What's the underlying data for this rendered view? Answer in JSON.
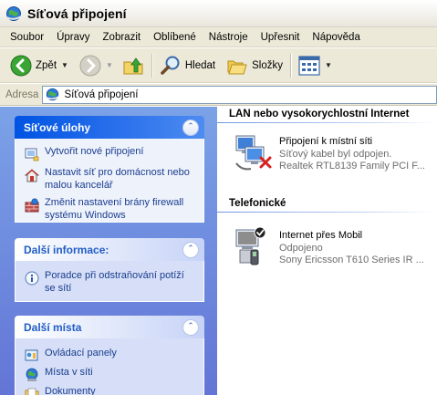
{
  "window": {
    "title": "Síťová připojení"
  },
  "menu": [
    "Soubor",
    "Úpravy",
    "Zobrazit",
    "Oblíbené",
    "Nástroje",
    "Upřesnit",
    "Nápověda"
  ],
  "toolbar": {
    "back_label": "Zpět",
    "search_label": "Hledat",
    "folders_label": "Složky"
  },
  "address": {
    "label": "Adresa",
    "value": "Síťová připojení"
  },
  "tasks": {
    "network_tasks": {
      "title": "Síťové úlohy",
      "items": [
        {
          "label": "Vytvořit nové připojení",
          "icon": "new-connection-icon"
        },
        {
          "label": "Nastavit síť pro domácnost nebo malou kancelář",
          "icon": "home-network-icon"
        },
        {
          "label": "Změnit nastavení brány firewall systému Windows",
          "icon": "firewall-icon"
        }
      ]
    },
    "more_info": {
      "title": "Další informace:",
      "items": [
        {
          "label": "Poradce při odstraňování potíží se sítí",
          "icon": "troubleshooter-icon"
        }
      ]
    },
    "other_places": {
      "title": "Další místa",
      "items": [
        {
          "label": "Ovládací panely",
          "icon": "control-panel-icon"
        },
        {
          "label": "Místa v síti",
          "icon": "network-places-icon"
        },
        {
          "label": "Dokumenty",
          "icon": "documents-icon"
        }
      ]
    }
  },
  "groups": [
    {
      "header": "LAN nebo vysokorychlostní Internet",
      "connections": [
        {
          "name": "Připojení k místní síti",
          "status": "Síťový kabel byl odpojen.",
          "device": "Realtek RTL8139 Family PCI F...",
          "icon": "lan-disconnected-icon"
        }
      ]
    },
    {
      "header": "Telefonické",
      "connections": [
        {
          "name": "Internet přes Mobil",
          "status": "Odpojeno",
          "device": "Sony Ericsson T610 Series IR ...",
          "icon": "dialup-modem-icon"
        }
      ]
    }
  ],
  "colors": {
    "accent": "#0054e3",
    "pane_top": "#7ba2e7",
    "pane_bottom": "#6375d6",
    "link": "#1a3d8f"
  }
}
